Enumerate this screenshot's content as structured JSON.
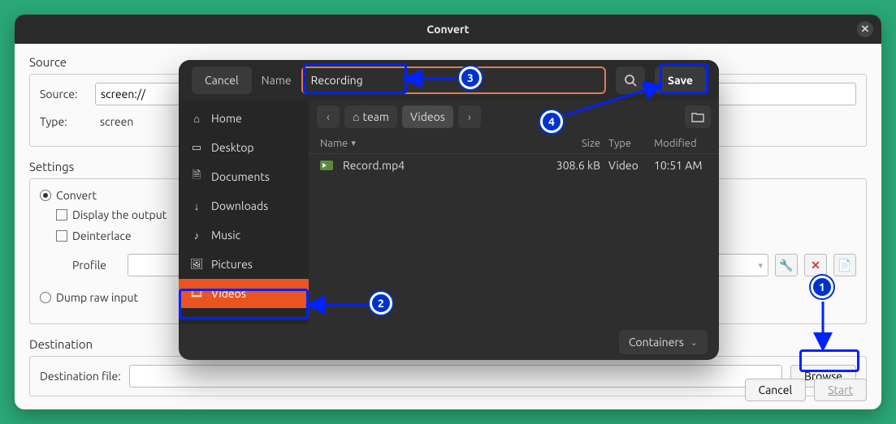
{
  "convert": {
    "title": "Convert",
    "source_section": "Source",
    "source_label": "Source:",
    "source_value": "screen://",
    "type_label": "Type:",
    "type_value": "screen",
    "settings_section": "Settings",
    "convert_option": "Convert",
    "display_output": "Display the output",
    "deinterlace": "Deinterlace",
    "profile_label": "Profile",
    "dump_option": "Dump raw input",
    "dest_section": "Destination",
    "dest_file_label": "Destination file:",
    "browse_btn": "Browse",
    "cancel_btn": "Cancel",
    "start_btn": "Start"
  },
  "dialog": {
    "cancel": "Cancel",
    "name_label": "Name",
    "name_value": "Recording",
    "save": "Save",
    "side": {
      "home": "Home",
      "desktop": "Desktop",
      "documents": "Documents",
      "downloads": "Downloads",
      "music": "Music",
      "pictures": "Pictures",
      "videos": "Videos"
    },
    "crumb_team": "team",
    "crumb_videos": "Videos",
    "head_name": "Name",
    "head_size": "Size",
    "head_type": "Type",
    "head_mod": "Modified",
    "file": {
      "name": "Record.mp4",
      "size": "308.6 kB",
      "type": "Video",
      "mod": "10:51 AM"
    },
    "filter": "Containers"
  },
  "annotations": {
    "n1": "1",
    "n2": "2",
    "n3": "3",
    "n4": "4"
  }
}
